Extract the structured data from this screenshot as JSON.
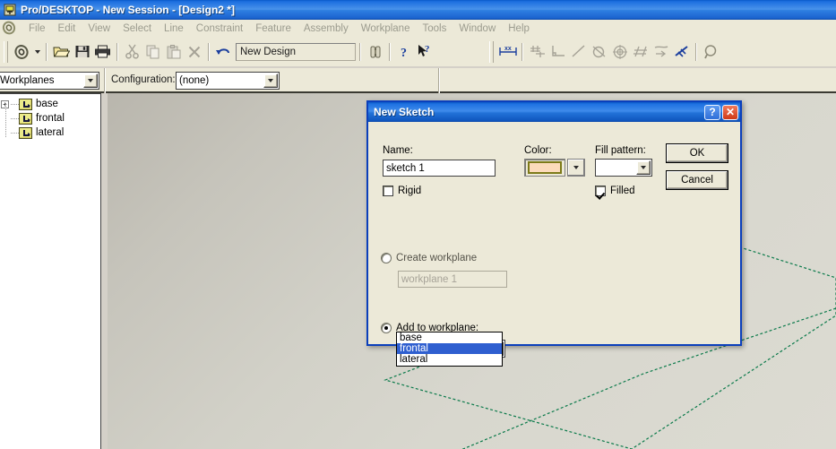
{
  "window": {
    "title": "Pro/DESKTOP - New Session - [Design2 *]",
    "icon": "app-icon"
  },
  "menubar": {
    "logo_icon": "proe-logo-icon",
    "items": [
      {
        "label": "File"
      },
      {
        "label": "Edit"
      },
      {
        "label": "View"
      },
      {
        "label": "Select"
      },
      {
        "label": "Line"
      },
      {
        "label": "Constraint"
      },
      {
        "label": "Feature"
      },
      {
        "label": "Assembly"
      },
      {
        "label": "Workplane"
      },
      {
        "label": "Tools"
      },
      {
        "label": "Window"
      },
      {
        "label": "Help"
      }
    ]
  },
  "toolbar_main": {
    "design_combo_value": "New Design",
    "icons": [
      "new-design-icon",
      "open-icon",
      "save-icon",
      "print-icon",
      "cut-icon",
      "copy-icon",
      "paste-icon",
      "delete-icon",
      "undo-icon",
      "binoculars-icon",
      "help-icon",
      "whats-this-icon"
    ],
    "constraint_icons": [
      "dimension-icon",
      "snap-grid-icon",
      "perpendicular-icon",
      "line-icon",
      "tangent-icon",
      "concentric-icon",
      "equal-icon",
      "parallel-icon",
      "fix-icon",
      "zoom-icon"
    ]
  },
  "toolbar_second": {
    "workplanes_combo_value": "Workplanes",
    "configuration_label": "Configuration:",
    "configuration_value": "(none)"
  },
  "tree": {
    "items": [
      {
        "label": "base",
        "expander": "+",
        "icon": "workplane-icon"
      },
      {
        "label": "frontal",
        "expander": "",
        "icon": "workplane-icon"
      },
      {
        "label": "lateral",
        "expander": "",
        "icon": "workplane-icon"
      }
    ]
  },
  "viewport": {
    "workplane_outline_color": "#0a7a4a"
  },
  "dialog": {
    "title": "New Sketch",
    "help_button": "?",
    "close_button": "✕",
    "name_label": "Name:",
    "name_value": "sketch 1",
    "color_label": "Color:",
    "color_swatch": "#fcdbbb",
    "color_swatch_border": "#7c7a18",
    "fill_pattern_label": "Fill pattern:",
    "fill_pattern_value": "",
    "rigid_label": "Rigid",
    "rigid_checked": false,
    "filled_label": "Filled",
    "filled_checked": true,
    "create_workplane_label": "Create workplane",
    "create_workplane_selected": false,
    "create_workplane_name": "workplane 1",
    "add_to_workplane_label": "Add to workplane:",
    "add_to_workplane_selected": true,
    "add_to_workplane_value": "base",
    "workplane_options": [
      {
        "label": "base",
        "selected": false
      },
      {
        "label": "frontal",
        "selected": true
      },
      {
        "label": "lateral",
        "selected": false
      }
    ],
    "ok_label": "OK",
    "cancel_label": "Cancel"
  }
}
